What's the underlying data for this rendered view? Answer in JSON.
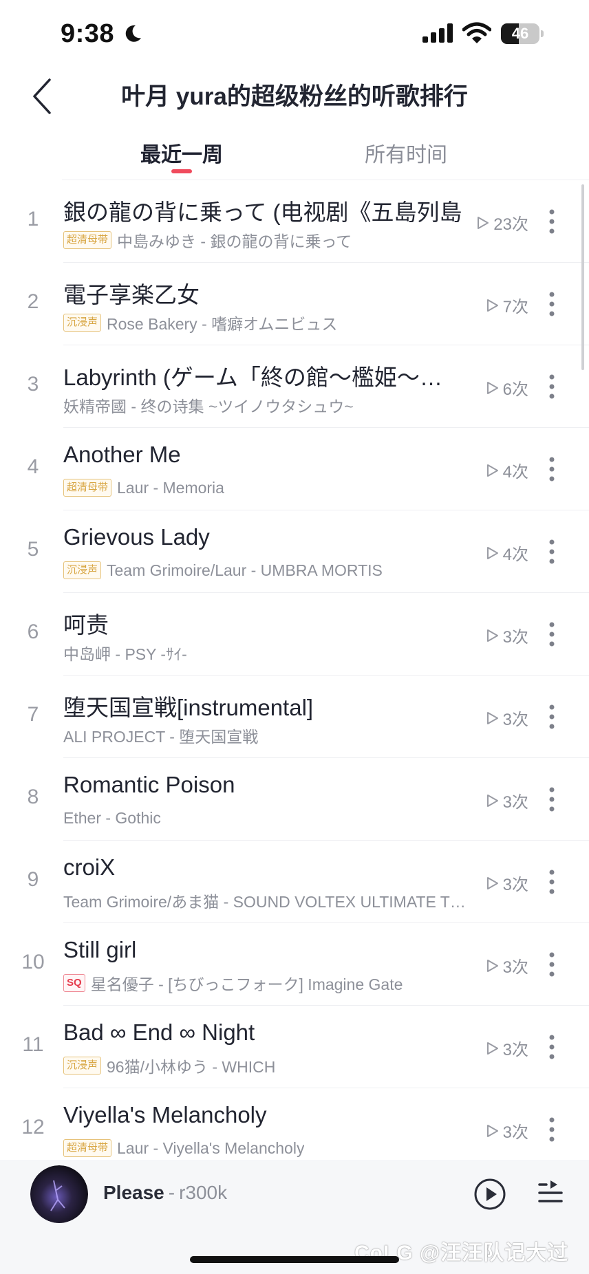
{
  "status_bar": {
    "time": "9:38",
    "battery_level": "46",
    "battery_fraction": 0.46
  },
  "header": {
    "title": "叶月 yura的超级粉丝的听歌排行"
  },
  "tabs": [
    {
      "label": "最近一周",
      "active": true
    },
    {
      "label": "所有时间",
      "active": false
    }
  ],
  "colors": {
    "accent": "#f04b5d",
    "tag_gold": "#d8a643",
    "tag_sq": "#e53b4c"
  },
  "songs": [
    {
      "rank": "1",
      "title": "銀の龍の背に乗って (电视剧《五島列島",
      "tag": "超清母带",
      "tag_style": "gold",
      "artist": "中島みゆき - 銀の龍の背に乗って",
      "plays": "23次"
    },
    {
      "rank": "2",
      "title": "電子享楽乙女",
      "tag": "沉浸声",
      "tag_style": "gold",
      "artist": "Rose Bakery - 嗜癖オムニビュス",
      "plays": "7次"
    },
    {
      "rank": "3",
      "title": "Labyrinth (ゲーム「終の館～檻姫～」テーマ",
      "tag": "",
      "tag_style": "",
      "artist": "妖精帝國 - 终の诗集 ~ツイノウタシュウ~",
      "plays": "6次"
    },
    {
      "rank": "4",
      "title": "Another Me",
      "tag": "超清母带",
      "tag_style": "gold",
      "artist": "Laur - Memoria",
      "plays": "4次"
    },
    {
      "rank": "5",
      "title": "Grievous Lady",
      "tag": "沉浸声",
      "tag_style": "gold",
      "artist": "Team Grimoire/Laur - UMBRA MORTIS",
      "plays": "4次"
    },
    {
      "rank": "6",
      "title": "呵责",
      "tag": "",
      "tag_style": "",
      "artist": "中岛岬 - PSY -ｻｲ-",
      "plays": "3次"
    },
    {
      "rank": "7",
      "title": "堕天国宣戦[instrumental]",
      "tag": "",
      "tag_style": "",
      "artist": "ALI PROJECT - 堕天国宣戦",
      "plays": "3次"
    },
    {
      "rank": "8",
      "title": "Romantic Poison",
      "tag": "",
      "tag_style": "",
      "artist": "Ether - Gothic",
      "plays": "3次"
    },
    {
      "rank": "9",
      "title": "croiX",
      "tag": "",
      "tag_style": "",
      "artist": "Team Grimoire/あま猫 - SOUND VOLTEX ULTIMATE TRACKS",
      "plays": "3次"
    },
    {
      "rank": "10",
      "title": "Still girl",
      "tag": "SQ",
      "tag_style": "sq",
      "artist": "星名優子 - [ちびっこフォーク] Imagine Gate",
      "plays": "3次"
    },
    {
      "rank": "11",
      "title": "Bad ∞ End ∞ Night",
      "tag": "沉浸声",
      "tag_style": "gold",
      "artist": "96猫/小林ゆう - WHICH",
      "plays": "3次"
    },
    {
      "rank": "12",
      "title": "Viyella's Melancholy",
      "tag": "超清母带",
      "tag_style": "gold",
      "artist": "Laur - Viyella's Melancholy",
      "plays": "3次"
    }
  ],
  "player": {
    "title": "Please",
    "separator": "-",
    "artist": "r300k"
  },
  "watermark": "CoLG @汪汪队记大过"
}
